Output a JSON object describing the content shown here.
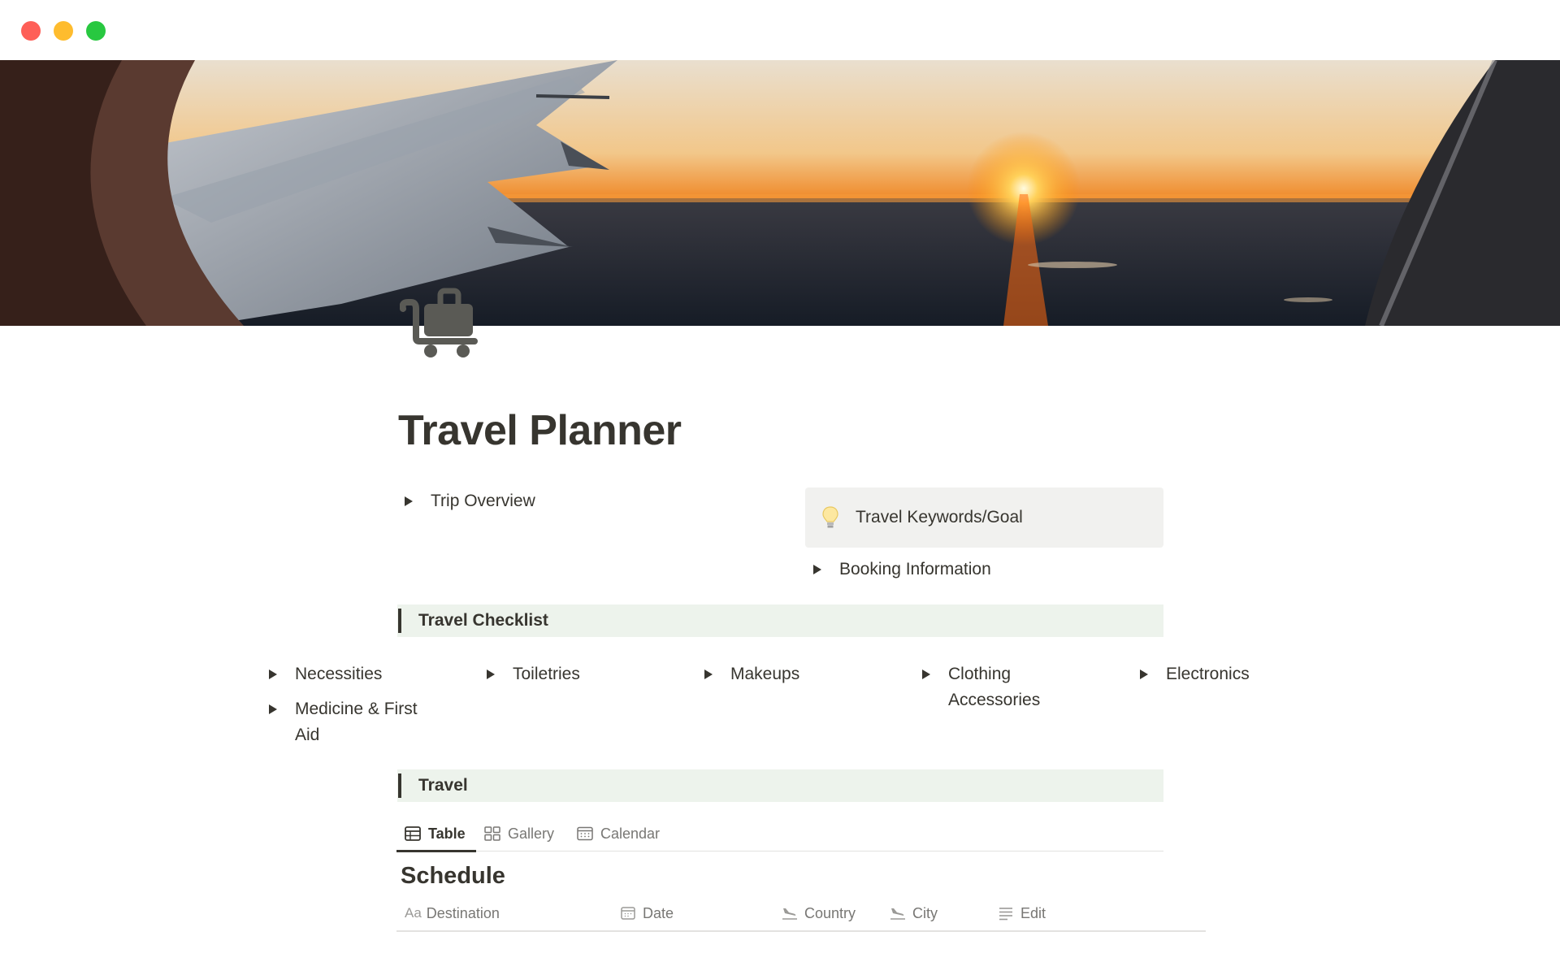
{
  "window": {
    "controls": [
      "close",
      "minimize",
      "maximize"
    ]
  },
  "cover": {
    "description_icon": "airplane-wing-sunset-cover"
  },
  "page": {
    "icon": "luggage-cart-icon",
    "title": "Travel Planner"
  },
  "overview": {
    "trip_overview": "Trip Overview",
    "callout_icon": "lightbulb-icon",
    "callout_text": "Travel Keywords/Goal",
    "booking_information": "Booking Information"
  },
  "checklist": {
    "heading": "Travel Checklist",
    "items": [
      "Necessities",
      "Toiletries",
      "Makeups",
      "Clothing Accessories",
      "Electronics",
      "Medicine & First Aid"
    ]
  },
  "travel": {
    "heading": "Travel",
    "tabs": [
      {
        "label": "Table",
        "icon": "table-icon"
      },
      {
        "label": "Gallery",
        "icon": "gallery-icon"
      },
      {
        "label": "Calendar",
        "icon": "calendar-icon"
      }
    ],
    "database_title": "Schedule",
    "columns": [
      {
        "label": "Destination",
        "icon": "Aa"
      },
      {
        "label": "Date",
        "icon": "calendar-icon"
      },
      {
        "label": "Country",
        "icon": "plane-landing-icon"
      },
      {
        "label": "City",
        "icon": "plane-landing-icon"
      },
      {
        "label": "Edit",
        "icon": "text-lines-icon"
      }
    ]
  },
  "colors": {
    "text": "#37352f",
    "muted": "#787774",
    "callout_bg": "#f1f1ef",
    "heading_bg": "#edf3ec",
    "close": "#fe5f57",
    "minimize": "#febc2e",
    "maximize": "#28c840"
  }
}
